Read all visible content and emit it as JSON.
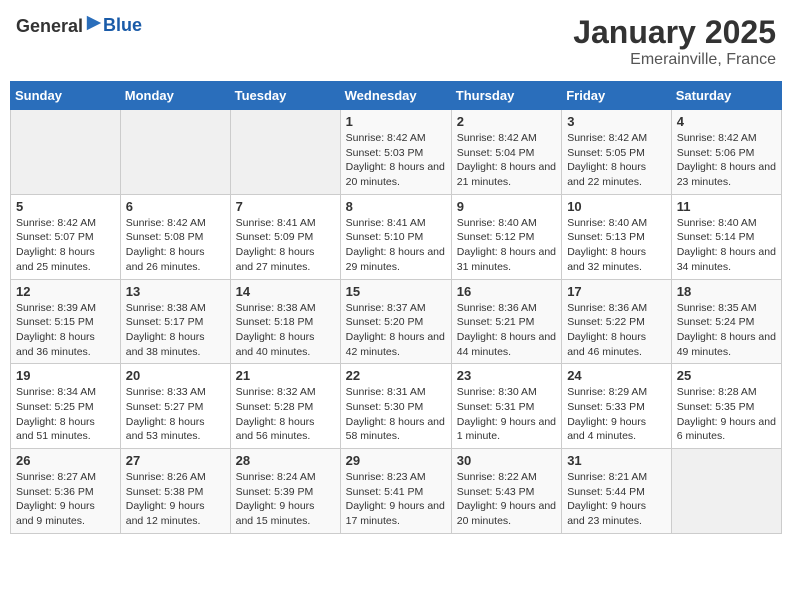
{
  "logo": {
    "general": "General",
    "blue": "Blue"
  },
  "header": {
    "month": "January 2025",
    "location": "Emerainville, France"
  },
  "weekdays": [
    "Sunday",
    "Monday",
    "Tuesday",
    "Wednesday",
    "Thursday",
    "Friday",
    "Saturday"
  ],
  "weeks": [
    [
      {
        "day": "",
        "sunrise": "",
        "sunset": "",
        "daylight": "",
        "empty": true
      },
      {
        "day": "",
        "sunrise": "",
        "sunset": "",
        "daylight": "",
        "empty": true
      },
      {
        "day": "",
        "sunrise": "",
        "sunset": "",
        "daylight": "",
        "empty": true
      },
      {
        "day": "1",
        "sunrise": "Sunrise: 8:42 AM",
        "sunset": "Sunset: 5:03 PM",
        "daylight": "Daylight: 8 hours and 20 minutes."
      },
      {
        "day": "2",
        "sunrise": "Sunrise: 8:42 AM",
        "sunset": "Sunset: 5:04 PM",
        "daylight": "Daylight: 8 hours and 21 minutes."
      },
      {
        "day": "3",
        "sunrise": "Sunrise: 8:42 AM",
        "sunset": "Sunset: 5:05 PM",
        "daylight": "Daylight: 8 hours and 22 minutes."
      },
      {
        "day": "4",
        "sunrise": "Sunrise: 8:42 AM",
        "sunset": "Sunset: 5:06 PM",
        "daylight": "Daylight: 8 hours and 23 minutes."
      }
    ],
    [
      {
        "day": "5",
        "sunrise": "Sunrise: 8:42 AM",
        "sunset": "Sunset: 5:07 PM",
        "daylight": "Daylight: 8 hours and 25 minutes."
      },
      {
        "day": "6",
        "sunrise": "Sunrise: 8:42 AM",
        "sunset": "Sunset: 5:08 PM",
        "daylight": "Daylight: 8 hours and 26 minutes."
      },
      {
        "day": "7",
        "sunrise": "Sunrise: 8:41 AM",
        "sunset": "Sunset: 5:09 PM",
        "daylight": "Daylight: 8 hours and 27 minutes."
      },
      {
        "day": "8",
        "sunrise": "Sunrise: 8:41 AM",
        "sunset": "Sunset: 5:10 PM",
        "daylight": "Daylight: 8 hours and 29 minutes."
      },
      {
        "day": "9",
        "sunrise": "Sunrise: 8:40 AM",
        "sunset": "Sunset: 5:12 PM",
        "daylight": "Daylight: 8 hours and 31 minutes."
      },
      {
        "day": "10",
        "sunrise": "Sunrise: 8:40 AM",
        "sunset": "Sunset: 5:13 PM",
        "daylight": "Daylight: 8 hours and 32 minutes."
      },
      {
        "day": "11",
        "sunrise": "Sunrise: 8:40 AM",
        "sunset": "Sunset: 5:14 PM",
        "daylight": "Daylight: 8 hours and 34 minutes."
      }
    ],
    [
      {
        "day": "12",
        "sunrise": "Sunrise: 8:39 AM",
        "sunset": "Sunset: 5:15 PM",
        "daylight": "Daylight: 8 hours and 36 minutes."
      },
      {
        "day": "13",
        "sunrise": "Sunrise: 8:38 AM",
        "sunset": "Sunset: 5:17 PM",
        "daylight": "Daylight: 8 hours and 38 minutes."
      },
      {
        "day": "14",
        "sunrise": "Sunrise: 8:38 AM",
        "sunset": "Sunset: 5:18 PM",
        "daylight": "Daylight: 8 hours and 40 minutes."
      },
      {
        "day": "15",
        "sunrise": "Sunrise: 8:37 AM",
        "sunset": "Sunset: 5:20 PM",
        "daylight": "Daylight: 8 hours and 42 minutes."
      },
      {
        "day": "16",
        "sunrise": "Sunrise: 8:36 AM",
        "sunset": "Sunset: 5:21 PM",
        "daylight": "Daylight: 8 hours and 44 minutes."
      },
      {
        "day": "17",
        "sunrise": "Sunrise: 8:36 AM",
        "sunset": "Sunset: 5:22 PM",
        "daylight": "Daylight: 8 hours and 46 minutes."
      },
      {
        "day": "18",
        "sunrise": "Sunrise: 8:35 AM",
        "sunset": "Sunset: 5:24 PM",
        "daylight": "Daylight: 8 hours and 49 minutes."
      }
    ],
    [
      {
        "day": "19",
        "sunrise": "Sunrise: 8:34 AM",
        "sunset": "Sunset: 5:25 PM",
        "daylight": "Daylight: 8 hours and 51 minutes."
      },
      {
        "day": "20",
        "sunrise": "Sunrise: 8:33 AM",
        "sunset": "Sunset: 5:27 PM",
        "daylight": "Daylight: 8 hours and 53 minutes."
      },
      {
        "day": "21",
        "sunrise": "Sunrise: 8:32 AM",
        "sunset": "Sunset: 5:28 PM",
        "daylight": "Daylight: 8 hours and 56 minutes."
      },
      {
        "day": "22",
        "sunrise": "Sunrise: 8:31 AM",
        "sunset": "Sunset: 5:30 PM",
        "daylight": "Daylight: 8 hours and 58 minutes."
      },
      {
        "day": "23",
        "sunrise": "Sunrise: 8:30 AM",
        "sunset": "Sunset: 5:31 PM",
        "daylight": "Daylight: 9 hours and 1 minute."
      },
      {
        "day": "24",
        "sunrise": "Sunrise: 8:29 AM",
        "sunset": "Sunset: 5:33 PM",
        "daylight": "Daylight: 9 hours and 4 minutes."
      },
      {
        "day": "25",
        "sunrise": "Sunrise: 8:28 AM",
        "sunset": "Sunset: 5:35 PM",
        "daylight": "Daylight: 9 hours and 6 minutes."
      }
    ],
    [
      {
        "day": "26",
        "sunrise": "Sunrise: 8:27 AM",
        "sunset": "Sunset: 5:36 PM",
        "daylight": "Daylight: 9 hours and 9 minutes."
      },
      {
        "day": "27",
        "sunrise": "Sunrise: 8:26 AM",
        "sunset": "Sunset: 5:38 PM",
        "daylight": "Daylight: 9 hours and 12 minutes."
      },
      {
        "day": "28",
        "sunrise": "Sunrise: 8:24 AM",
        "sunset": "Sunset: 5:39 PM",
        "daylight": "Daylight: 9 hours and 15 minutes."
      },
      {
        "day": "29",
        "sunrise": "Sunrise: 8:23 AM",
        "sunset": "Sunset: 5:41 PM",
        "daylight": "Daylight: 9 hours and 17 minutes."
      },
      {
        "day": "30",
        "sunrise": "Sunrise: 8:22 AM",
        "sunset": "Sunset: 5:43 PM",
        "daylight": "Daylight: 9 hours and 20 minutes."
      },
      {
        "day": "31",
        "sunrise": "Sunrise: 8:21 AM",
        "sunset": "Sunset: 5:44 PM",
        "daylight": "Daylight: 9 hours and 23 minutes."
      },
      {
        "day": "",
        "sunrise": "",
        "sunset": "",
        "daylight": "",
        "empty": true
      }
    ]
  ]
}
